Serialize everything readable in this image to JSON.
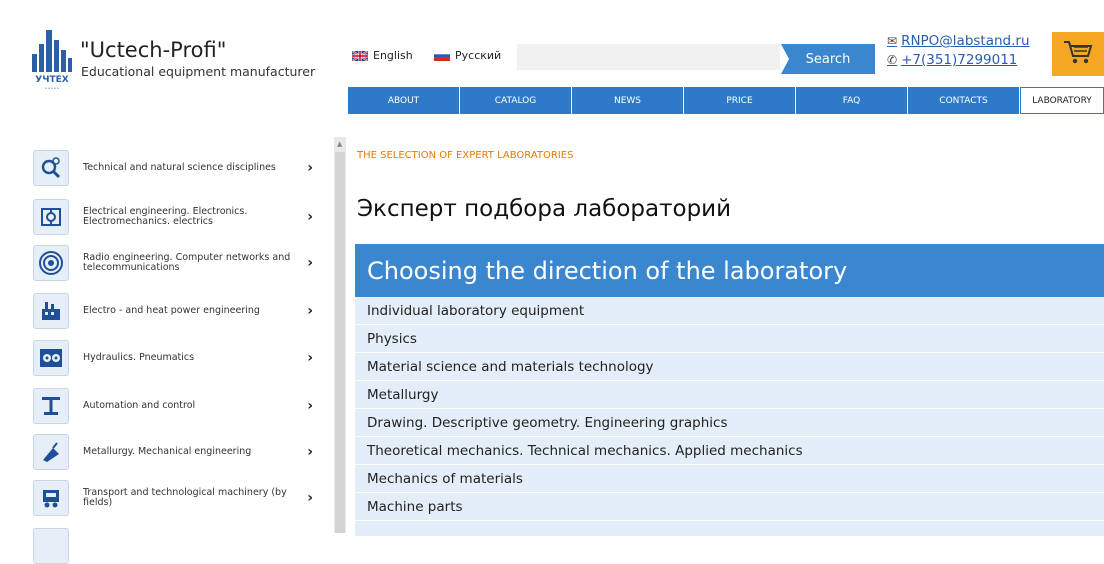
{
  "header": {
    "brand_title": "\"Uctech-Profi\"",
    "brand_subtitle": "Educational equipment manufacturer",
    "logo_text": "УЧТЕХ",
    "lang_english": "English",
    "lang_russian": "Русский",
    "search_placeholder": "",
    "search_label": "Search",
    "email": "RNPO@labstand.ru",
    "phone": "+7(351)7299011",
    "accent_color": "#3a87d0",
    "cart_color": "#f5a623"
  },
  "nav": [
    {
      "label": "ABOUT"
    },
    {
      "label": "CATALOG"
    },
    {
      "label": "NEWS"
    },
    {
      "label": "PRICE"
    },
    {
      "label": "FAQ"
    },
    {
      "label": "CONTACTS"
    },
    {
      "label": "LABORATORY"
    }
  ],
  "sidebar": {
    "items": [
      {
        "label": "Technical and natural science disciplines",
        "icon": "magnifier-atom-icon"
      },
      {
        "label": "Electrical engineering. Electronics. Electromechanics. electrics",
        "icon": "circuit-icon"
      },
      {
        "label": "Radio engineering. Computer networks and telecommunications",
        "icon": "antenna-icon"
      },
      {
        "label": "Electro - and heat power engineering",
        "icon": "power-plant-icon"
      },
      {
        "label": "Hydraulics. Pneumatics",
        "icon": "gear-pipes-icon"
      },
      {
        "label": "Automation and control",
        "icon": "robot-arm-icon"
      },
      {
        "label": "Metallurgy. Mechanical engineering",
        "icon": "ladle-icon"
      },
      {
        "label": "Transport and technological machinery (by fields)",
        "icon": "transport-icon"
      }
    ],
    "chevron": "›"
  },
  "main": {
    "breadcrumb": "THE SELECTION OF EXPERT LABORATORIES",
    "title": "Эксперт подбора лабораторий",
    "section_title": "Choosing the direction of the laboratory",
    "directions": [
      "Individual laboratory equipment",
      "Physics",
      "Material science and materials technology",
      "Metallurgy",
      "Drawing. Descriptive geometry. Engineering graphics",
      "Theoretical mechanics. Technical mechanics. Applied mechanics",
      "Mechanics of materials",
      "Machine parts"
    ]
  }
}
